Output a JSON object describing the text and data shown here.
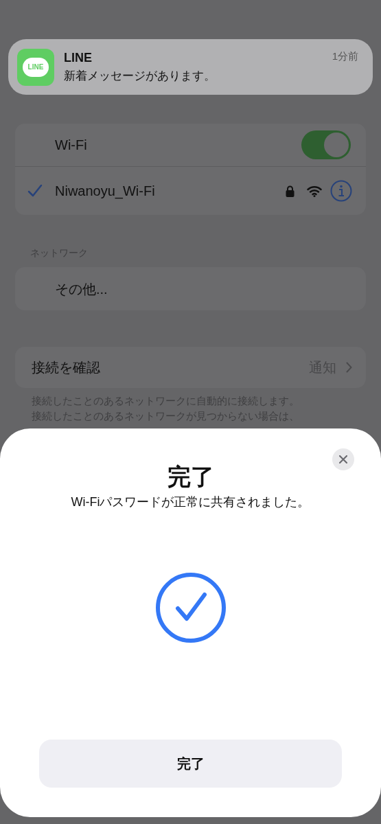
{
  "notification": {
    "app": "LINE",
    "icon_text": "LINE",
    "time": "1分前",
    "message": "新着メッセージがあります。"
  },
  "wifi": {
    "label": "Wi-Fi",
    "on": true,
    "network": {
      "name": "Niwanoyu_Wi-Fi",
      "selected": true,
      "secured": true
    }
  },
  "networks": {
    "header": "ネットワーク",
    "items": [
      {
        "label": "その他..."
      }
    ]
  },
  "ask_to_join": {
    "label": "接続を確認",
    "value": "通知"
  },
  "footer_lines": [
    "接続したことのあるネットワークに自動的に接続します。",
    "接続したことのあるネットワークが見つからない場合は、"
  ],
  "sheet": {
    "title": "完了",
    "subtitle": "Wi-Fiパスワードが正常に共有されました。",
    "button": "完了"
  }
}
